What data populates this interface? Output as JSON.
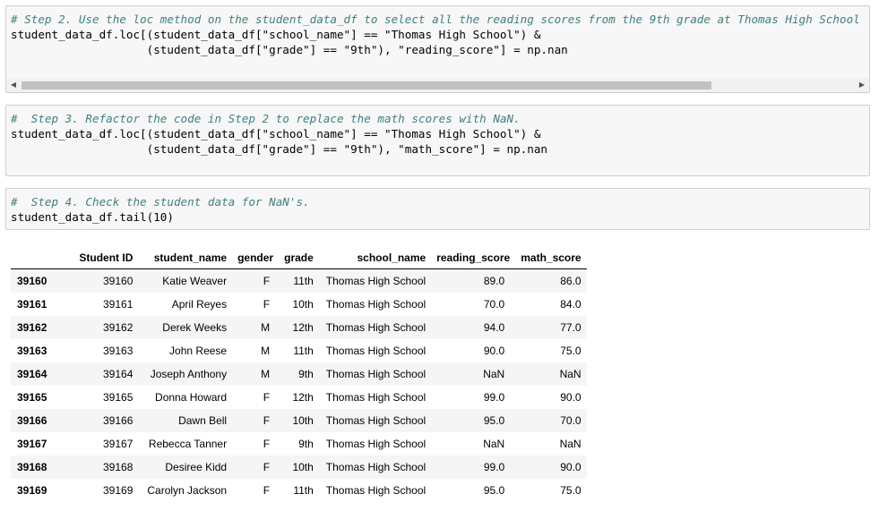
{
  "cells": [
    {
      "lines": [
        "# Step 2. Use the loc method on the student_data_df to select all the reading scores from the 9th grade at Thomas High School",
        "student_data_df.loc[(student_data_df[\"school_name\"] == \"Thomas High School\") &",
        "                    (student_data_df[\"grade\"] == \"9th\"), \"reading_score\"] = np.nan"
      ],
      "scrollbar": {
        "left_arrow": "◀",
        "right_arrow": "▶"
      }
    },
    {
      "lines": [
        "#  Step 3. Refactor the code in Step 2 to replace the math scores with NaN.",
        "student_data_df.loc[(student_data_df[\"school_name\"] == \"Thomas High School\") &",
        "                    (student_data_df[\"grade\"] == \"9th\"), \"math_score\"] = np.nan"
      ]
    },
    {
      "lines": [
        "#  Step 4. Check the student data for NaN's.",
        "student_data_df.tail(10)"
      ]
    }
  ],
  "table": {
    "columns": [
      "Student ID",
      "student_name",
      "gender",
      "grade",
      "school_name",
      "reading_score",
      "math_score"
    ],
    "rows": [
      {
        "index": "39160",
        "cells": [
          "39160",
          "Katie Weaver",
          "F",
          "11th",
          "Thomas High School",
          "89.0",
          "86.0"
        ]
      },
      {
        "index": "39161",
        "cells": [
          "39161",
          "April Reyes",
          "F",
          "10th",
          "Thomas High School",
          "70.0",
          "84.0"
        ]
      },
      {
        "index": "39162",
        "cells": [
          "39162",
          "Derek Weeks",
          "M",
          "12th",
          "Thomas High School",
          "94.0",
          "77.0"
        ]
      },
      {
        "index": "39163",
        "cells": [
          "39163",
          "John Reese",
          "M",
          "11th",
          "Thomas High School",
          "90.0",
          "75.0"
        ]
      },
      {
        "index": "39164",
        "cells": [
          "39164",
          "Joseph Anthony",
          "M",
          "9th",
          "Thomas High School",
          "NaN",
          "NaN"
        ]
      },
      {
        "index": "39165",
        "cells": [
          "39165",
          "Donna Howard",
          "F",
          "12th",
          "Thomas High School",
          "99.0",
          "90.0"
        ]
      },
      {
        "index": "39166",
        "cells": [
          "39166",
          "Dawn Bell",
          "F",
          "10th",
          "Thomas High School",
          "95.0",
          "70.0"
        ]
      },
      {
        "index": "39167",
        "cells": [
          "39167",
          "Rebecca Tanner",
          "F",
          "9th",
          "Thomas High School",
          "NaN",
          "NaN"
        ]
      },
      {
        "index": "39168",
        "cells": [
          "39168",
          "Desiree Kidd",
          "F",
          "10th",
          "Thomas High School",
          "99.0",
          "90.0"
        ]
      },
      {
        "index": "39169",
        "cells": [
          "39169",
          "Carolyn Jackson",
          "F",
          "11th",
          "Thomas High School",
          "95.0",
          "75.0"
        ]
      }
    ]
  }
}
